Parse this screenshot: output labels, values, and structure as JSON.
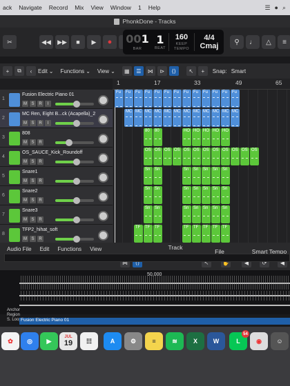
{
  "menubar": {
    "items": [
      "ack",
      "Navigate",
      "Record",
      "Mix",
      "View",
      "Window",
      "1",
      "Help"
    ]
  },
  "window": {
    "title": "PhonkDone - Tracks"
  },
  "lcd": {
    "bar_dim": "00",
    "bar": "1",
    "beat": "1",
    "bar_label": "BAR",
    "beat_label": "BEAT",
    "tempo": "160",
    "tempo_label": "KEEP",
    "tempo_sub": "TEMPO",
    "time_sig": "4/4",
    "key": "Cmaj"
  },
  "toolbar": {
    "edit": "Edit",
    "functions": "Functions",
    "view": "View",
    "snap_label": "Snap:",
    "snap_value": "Smart"
  },
  "ruler": {
    "marks": [
      "1",
      "17",
      "33",
      "49",
      "65"
    ]
  },
  "tracks": [
    {
      "num": "1",
      "name": "Fusion Electric Piano 01",
      "type": "audio",
      "fader": 0.55,
      "sel": false
    },
    {
      "num": "2",
      "name": "MC Ren, Eight B...ck (Acapella)_2",
      "type": "audio",
      "fader": 0.55,
      "sel": true
    },
    {
      "num": "3",
      "name": "808",
      "type": "drum",
      "fader": 0.35,
      "sel": false
    },
    {
      "num": "4",
      "name": "OS_SAUCE_Kick_Roundoff",
      "type": "drum",
      "fader": 0.55,
      "sel": false
    },
    {
      "num": "5",
      "name": "Snare1",
      "type": "drum",
      "fader": 0.55,
      "sel": false
    },
    {
      "num": "6",
      "name": "Snare2",
      "type": "drum",
      "fader": 0.55,
      "sel": false
    },
    {
      "num": "7",
      "name": "Snare3",
      "type": "drum",
      "fader": 0.55,
      "sel": false
    },
    {
      "num": "8",
      "name": "TFP2_hihat_soft",
      "type": "drum",
      "fader": 0.55,
      "sel": false
    }
  ],
  "track_buttons": {
    "m": "M",
    "s": "S",
    "r": "R",
    "i": "I"
  },
  "regions": {
    "fu": "Fu",
    "mc": "MC",
    "b808": "80",
    "ho": "HO",
    "os": "OS",
    "sn": "Sn",
    "tf": "TF"
  },
  "editor": {
    "audio_file": "Audio File",
    "edit": "Edit",
    "functions": "Functions",
    "view": "View",
    "tab_track": "Track",
    "tab_file": "File",
    "tab_smart": "Smart Tempo",
    "marker": "50,000",
    "anchor": "Anchor",
    "region": "Region",
    "loop": "S. Loop",
    "region_name": "Fusion Electric Piano 01"
  },
  "dock": {
    "calendar_month": "JUL",
    "calendar_day": "19",
    "line_badge": "54"
  },
  "colors": {
    "audio_region": "#4f8fd9",
    "midi_region": "#5cc73a",
    "record": "#e0383e",
    "accent": "#1f5fa8"
  }
}
